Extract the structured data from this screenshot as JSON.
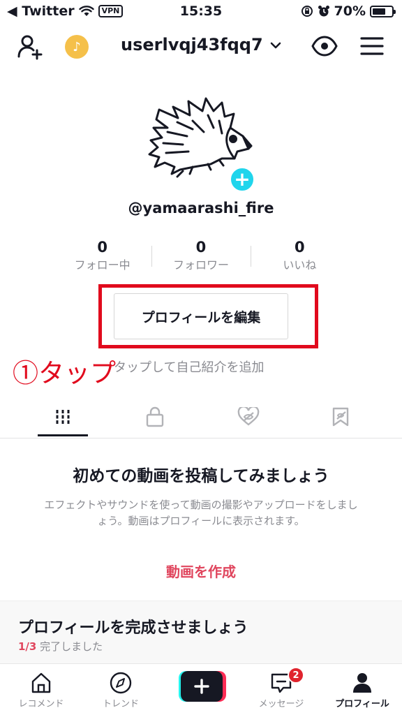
{
  "status_bar": {
    "back_app": "◀ Twitter",
    "vpn": "VPN",
    "time": "15:35",
    "battery": "70%",
    "battery_level": 0.7
  },
  "header": {
    "username": "userlvqj43fqq7"
  },
  "profile": {
    "handle": "@yamaarashi_fire",
    "stats": [
      {
        "value": "0",
        "label": "フォロー中"
      },
      {
        "value": "0",
        "label": "フォロワー"
      },
      {
        "value": "0",
        "label": "いいね"
      }
    ],
    "edit_button": "プロフィールを編集",
    "annotation": "①タップ",
    "bio_placeholder": "タップして自己紹介を追加"
  },
  "tabs": {
    "icons": [
      "videos-grid-icon",
      "lock-icon",
      "liked-hidden-icon",
      "saved-hidden-icon"
    ]
  },
  "empty_state": {
    "title": "初めての動画を投稿してみましょう",
    "description": "エフェクトやサウンドを使って動画の撮影やアップロードをしましょう。動画はプロフィールに表示されます。",
    "create_link": "動画を作成"
  },
  "complete_profile": {
    "title": "プロフィールを完成させましょう",
    "progress_fraction": "1/3",
    "progress_text": " 完了しました"
  },
  "bottom_nav": {
    "items": [
      {
        "label": "レコメンド",
        "icon": "home-icon"
      },
      {
        "label": "トレンド",
        "icon": "compass-icon"
      },
      {
        "label": "",
        "icon": "create-plus-icon"
      },
      {
        "label": "メッセージ",
        "icon": "message-icon",
        "badge": "2"
      },
      {
        "label": "プロフィール",
        "icon": "profile-icon"
      }
    ]
  },
  "colors": {
    "highlight_red": "#e10a1d",
    "accent_pink": "#e0465e",
    "avatar_plus": "#20d5ec",
    "coin_gold": "#f5c04a"
  }
}
